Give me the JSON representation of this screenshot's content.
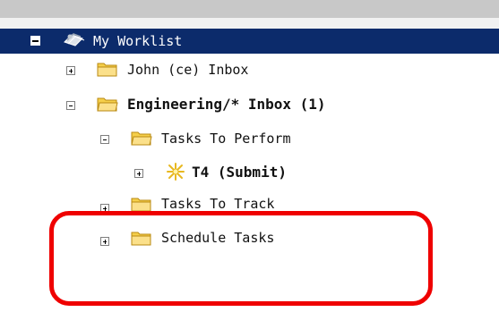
{
  "tree": {
    "root": {
      "label": "My Worklist",
      "icon": "worklist-icon",
      "expanded": true
    },
    "nodes": [
      {
        "label": "John (ce) Inbox",
        "icon": "folder-icon",
        "expanded": false,
        "bold": false
      },
      {
        "label": "Engineering/* Inbox (1)",
        "icon": "folder-open-icon",
        "expanded": true,
        "bold": true
      },
      {
        "label": "Tasks To Perform",
        "icon": "folder-open-icon",
        "expanded": true,
        "bold": false
      },
      {
        "label": "T4 (Submit)",
        "icon": "sparkle-task-icon",
        "expanded": false,
        "bold": true
      },
      {
        "label": "Tasks To Track",
        "icon": "folder-icon",
        "expanded": false,
        "bold": false
      },
      {
        "label": "Schedule Tasks",
        "icon": "folder-icon",
        "expanded": false,
        "bold": false
      }
    ]
  },
  "colors": {
    "selection_bg": "#0c2b6b",
    "highlight_border": "#ef0000",
    "folder": "#f5cf4a"
  }
}
